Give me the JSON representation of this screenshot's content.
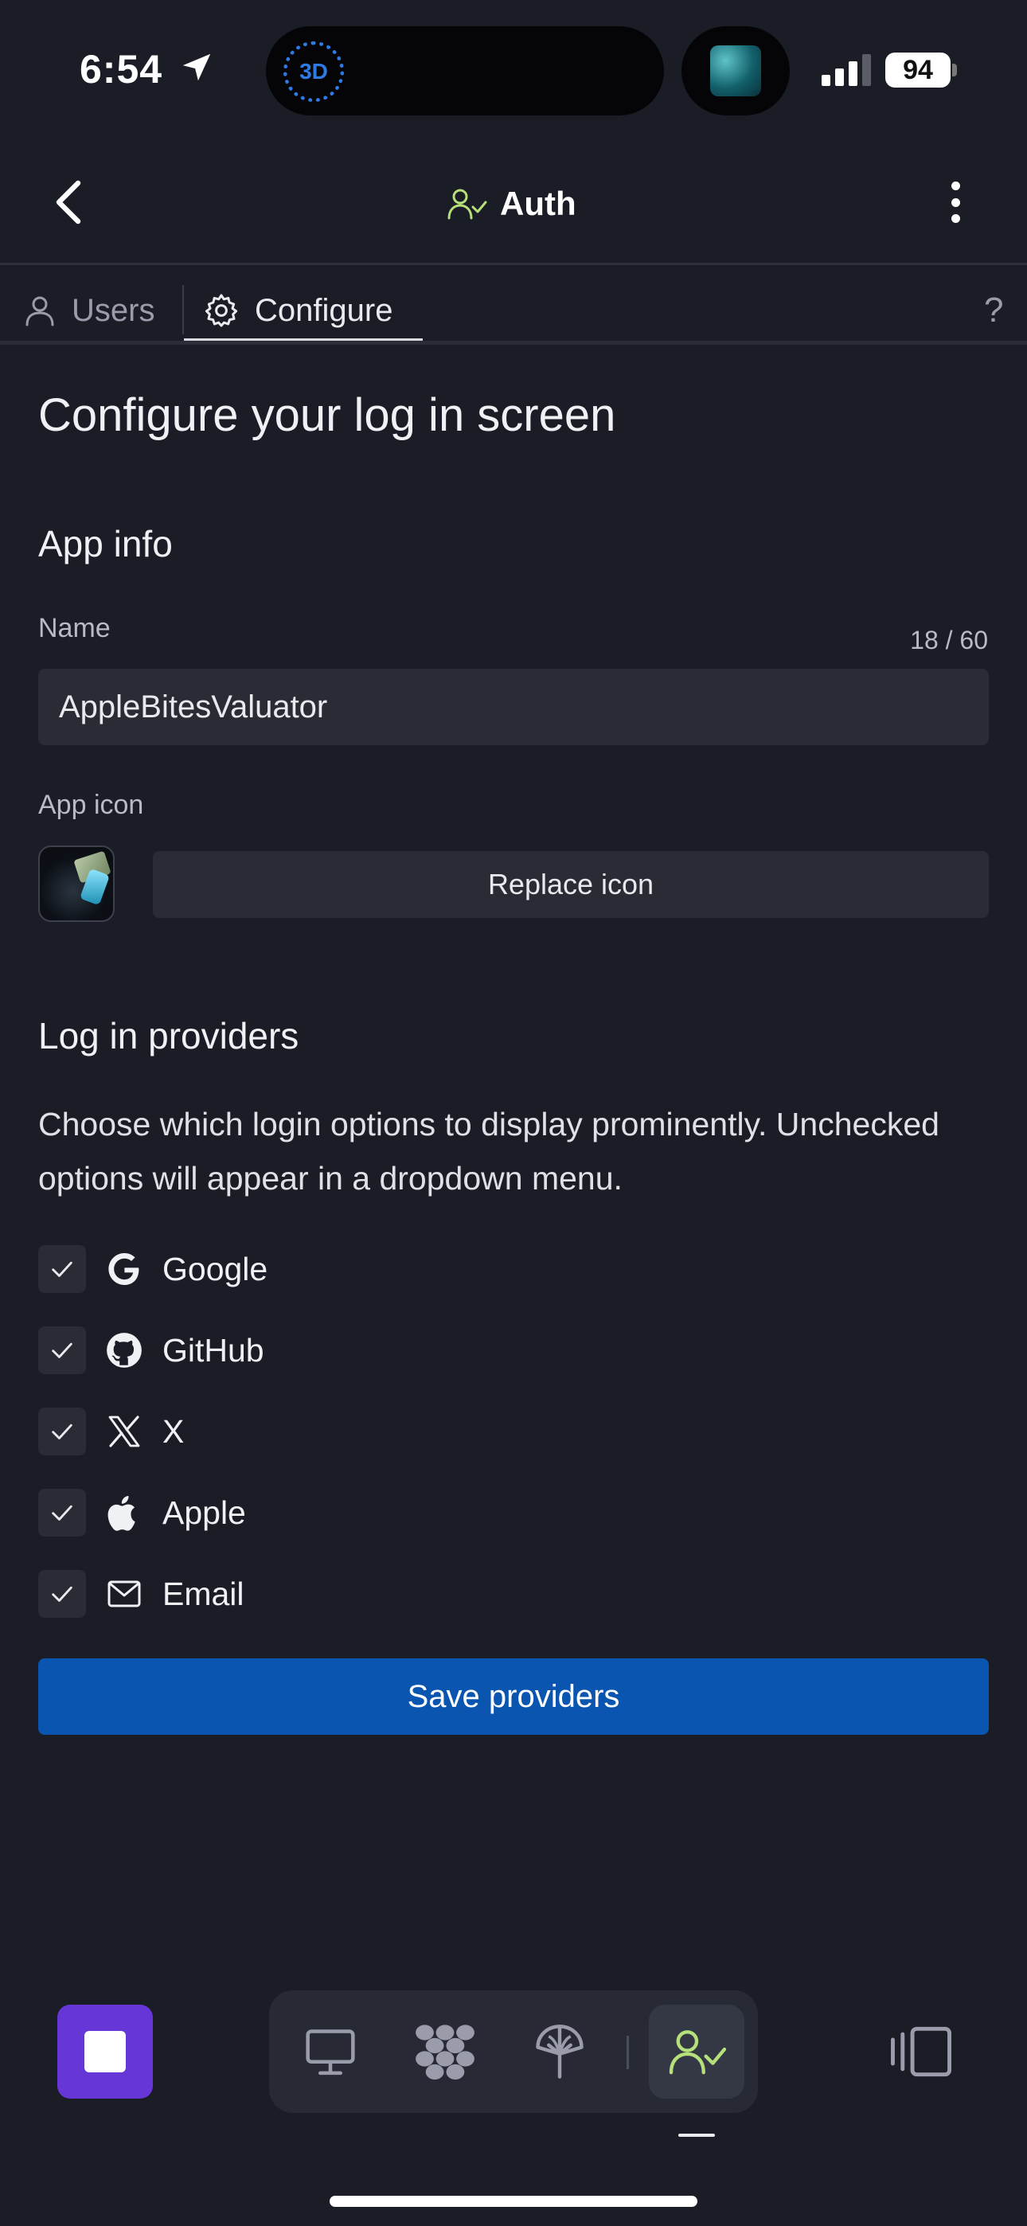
{
  "status_bar": {
    "time": "6:54",
    "dynamic_island_badge": "3D",
    "battery": "94"
  },
  "header": {
    "title": "Auth",
    "title_icon": "user-check-icon",
    "back_icon": "chevron-left-icon",
    "menu_icon": "more-vertical-icon"
  },
  "tabs": [
    {
      "label": "Users",
      "icon": "user-icon",
      "active": false
    },
    {
      "label": "Configure",
      "icon": "gear-icon",
      "active": true
    }
  ],
  "help_label": "?",
  "page": {
    "title": "Configure your log in screen"
  },
  "app_info": {
    "section_title": "App info",
    "name_label": "Name",
    "name_value": "AppleBitesValuator",
    "name_counter": "18 / 60",
    "icon_label": "App icon",
    "replace_icon_label": "Replace icon"
  },
  "providers": {
    "section_title": "Log in providers",
    "description": "Choose which login options to display prominently. Unchecked options will appear in a dropdown menu.",
    "items": [
      {
        "label": "Google",
        "icon": "google-icon",
        "checked": true
      },
      {
        "label": "GitHub",
        "icon": "github-icon",
        "checked": true
      },
      {
        "label": "X",
        "icon": "x-icon",
        "checked": true
      },
      {
        "label": "Apple",
        "icon": "apple-icon",
        "checked": true
      },
      {
        "label": "Email",
        "icon": "mail-icon",
        "checked": true
      }
    ],
    "save_label": "Save providers"
  },
  "toolbar": {
    "items": [
      "monitor-icon",
      "apps-grid-icon",
      "deploy-icon",
      "user-check-icon"
    ],
    "active": "user-check-icon"
  },
  "colors": {
    "background": "#1b1d26",
    "surface": "#2a2c35",
    "primary": "#0a55b0",
    "accent_green": "#b6e07a",
    "stop_button": "#6637d6"
  }
}
